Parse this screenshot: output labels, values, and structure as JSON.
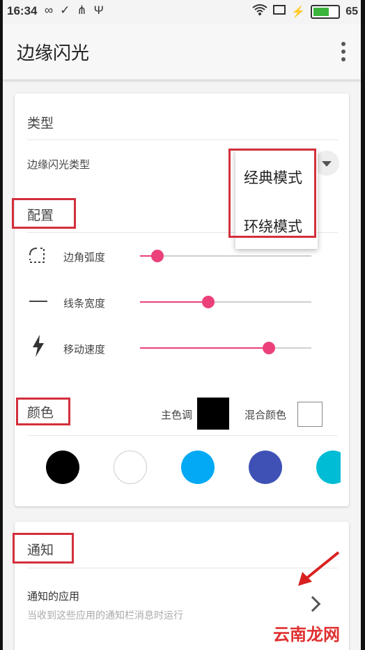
{
  "status_bar": {
    "time": "16:34",
    "battery_pct": "65",
    "battery_level": 0.65
  },
  "toolbar": {
    "title": "边缘闪光"
  },
  "type_section": {
    "title": "类型",
    "flash_type_label": "边缘闪光类型",
    "dropdown_options": [
      "经典模式",
      "环绕模式"
    ]
  },
  "config_section": {
    "title": "配置",
    "sliders": [
      {
        "label": "边角弧度",
        "value": 0.1
      },
      {
        "label": "线条宽度",
        "value": 0.4
      },
      {
        "label": "移动速度",
        "value": 0.75
      }
    ]
  },
  "color_section": {
    "title": "颜色",
    "main_tone_label": "主色调",
    "main_tone_color": "#000000",
    "mix_color_label": "混合颜色",
    "mix_color": "#ffffff",
    "palette": [
      "#000000",
      "#ffffff",
      "#03a9f4",
      "#3f51b5",
      "#00bcd4"
    ]
  },
  "notify_section": {
    "title": "通知",
    "app_title": "通知的应用",
    "app_subtitle": "当收到这些应用的通知栏消息时运行"
  },
  "accent_color": "#ec407a",
  "watermark": "云南龙网"
}
